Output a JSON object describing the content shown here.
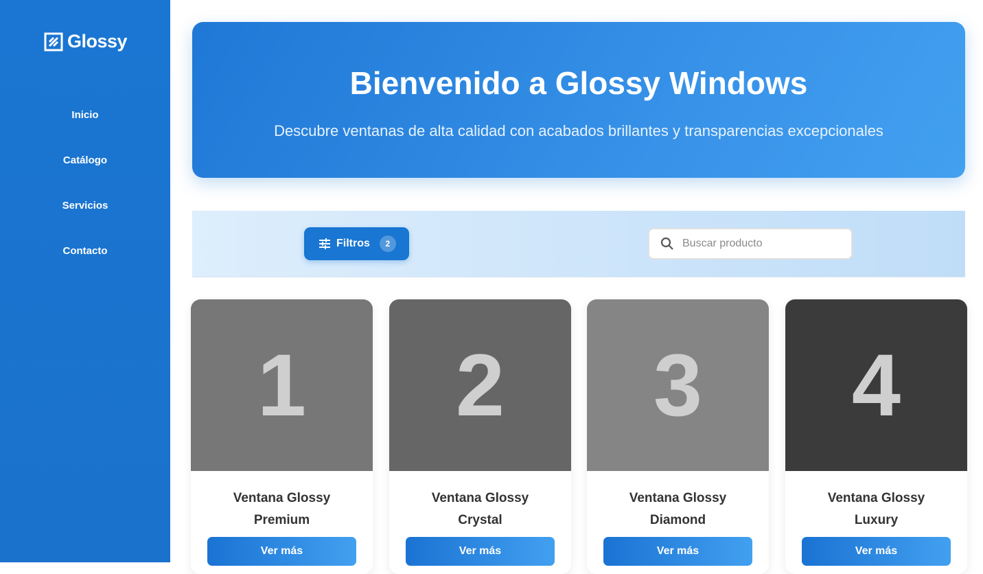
{
  "sidebar": {
    "logo": "Glossy",
    "items": [
      {
        "label": "Inicio"
      },
      {
        "label": "Catálogo"
      },
      {
        "label": "Servicios"
      },
      {
        "label": "Contacto"
      }
    ]
  },
  "hero": {
    "title": "Bienvenido a Glossy Windows",
    "subtitle": "Descubre ventanas de alta calidad con acabados brillantes y transparencias excepcionales"
  },
  "toolbar": {
    "filter_label": "Filtros",
    "filter_count": "2",
    "search_placeholder": "Buscar producto",
    "search_value": ""
  },
  "products": [
    {
      "number": "1",
      "name": "Ventana Glossy Premium",
      "button": "Ver más",
      "color": "#777777"
    },
    {
      "number": "2",
      "name": "Ventana Glossy Crystal",
      "button": "Ver más",
      "color": "#666666"
    },
    {
      "number": "3",
      "name": "Ventana Glossy Diamond",
      "button": "Ver más",
      "color": "#858585"
    },
    {
      "number": "4",
      "name": "Ventana Glossy Luxury",
      "button": "Ver más",
      "color": "#3b3b3b"
    }
  ]
}
